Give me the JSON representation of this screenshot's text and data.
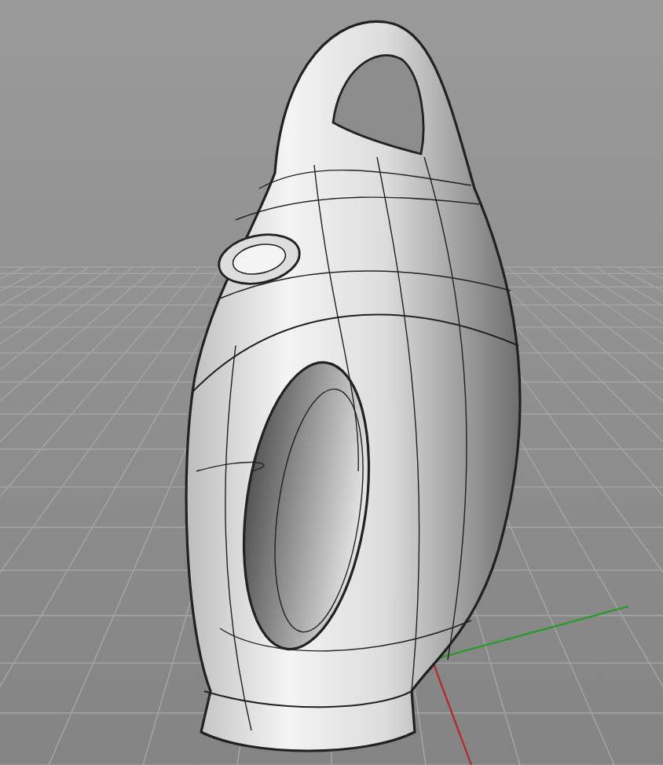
{
  "viewport": {
    "show_grid": true,
    "show_world_axes": true
  }
}
